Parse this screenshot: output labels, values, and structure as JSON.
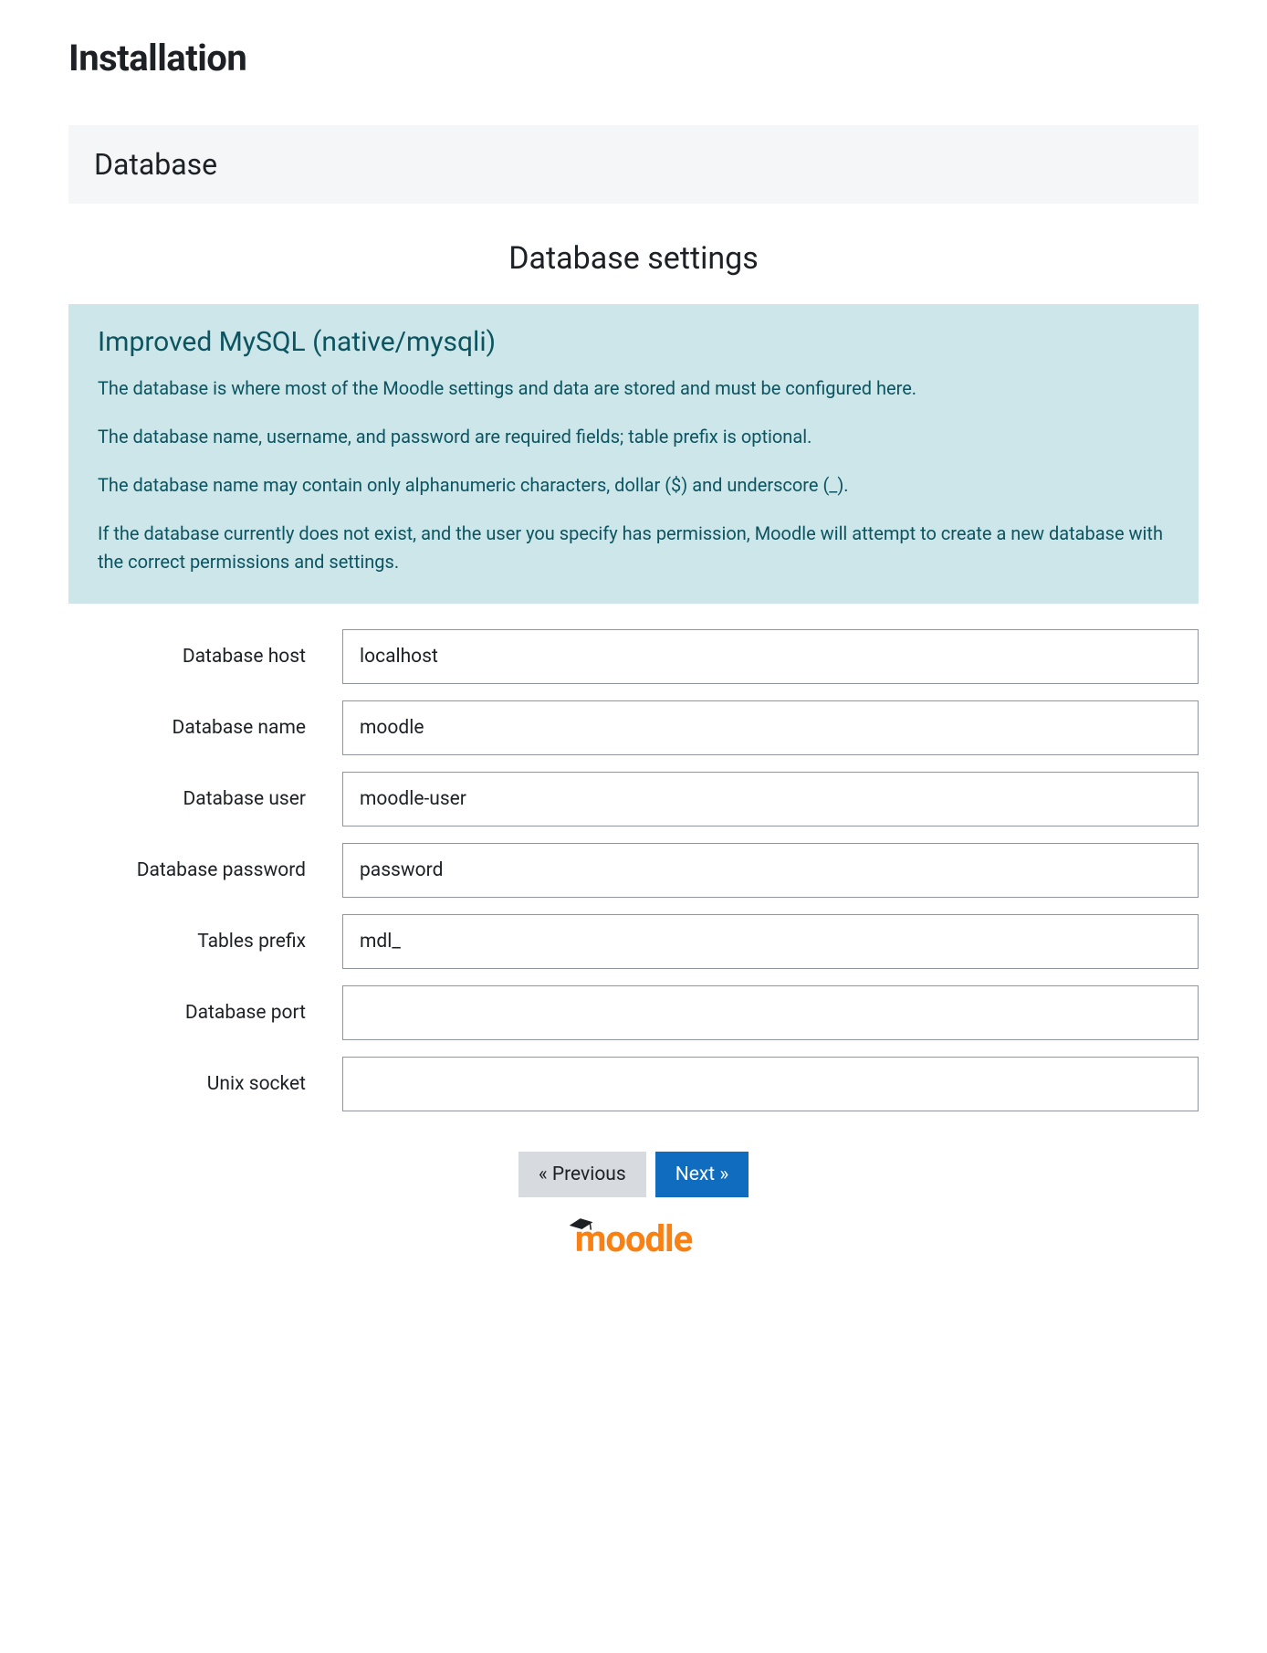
{
  "page": {
    "title": "Installation"
  },
  "panel": {
    "heading": "Database"
  },
  "section": {
    "title": "Database settings"
  },
  "info": {
    "heading": "Improved MySQL (native/mysqli)",
    "p1": "The database is where most of the Moodle settings and data are stored and must be configured here.",
    "p2": "The database name, username, and password are required fields; table prefix is optional.",
    "p3": "The database name may contain only alphanumeric characters, dollar ($) and underscore (_).",
    "p4": "If the database currently does not exist, and the user you specify has permission, Moodle will attempt to create a new database with the correct permissions and settings."
  },
  "form": {
    "fields": [
      {
        "label": "Database host",
        "value": "localhost"
      },
      {
        "label": "Database name",
        "value": "moodle"
      },
      {
        "label": "Database user",
        "value": "moodle-user"
      },
      {
        "label": "Database password",
        "value": "password"
      },
      {
        "label": "Tables prefix",
        "value": "mdl_"
      },
      {
        "label": "Database port",
        "value": ""
      },
      {
        "label": "Unix socket",
        "value": ""
      }
    ]
  },
  "buttons": {
    "previous": "« Previous",
    "next": "Next »"
  },
  "logo": {
    "text": "moodle"
  }
}
